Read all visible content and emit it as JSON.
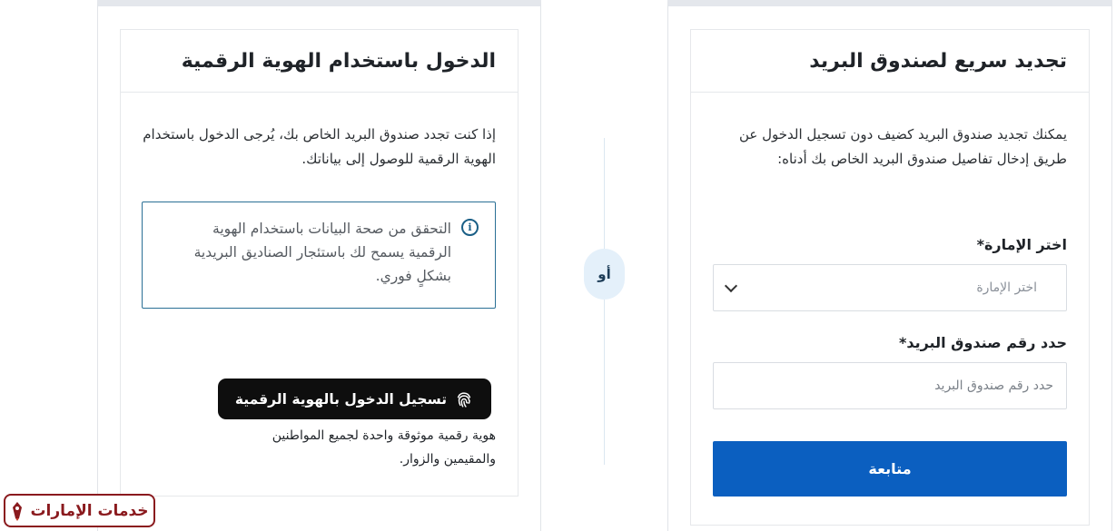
{
  "left_card": {
    "title": "الدخول باستخدام الهوية الرقمية",
    "description": "إذا كنت تجدد صندوق البريد الخاص بك، يُرجى الدخول باستخدام الهوية الرقمية للوصول إلى بياناتك.",
    "info_text": "التحقق من صحة البيانات باستخدام الهوية الرقمية يسمح لك باستئجار الصناديق البريدية بشكلٍ فوري.",
    "uaepass_button_label": "تسجيل الدخول بالهوية الرقمية",
    "uaepass_note": "هوية رقمية موثوقة واحدة لجميع المواطنين والمقيمين والزوار."
  },
  "separator": {
    "or_label": "أو"
  },
  "right_card": {
    "title": "تجديد سريع لصندوق البريد",
    "description": "يمكنك تجديد صندوق البريد كضيف دون تسجيل الدخول عن طريق إدخال تفاصيل صندوق البريد الخاص بك أدناه:",
    "emirate_label": "اختر الإمارة*",
    "emirate_placeholder": "اختر الإمارة",
    "pobox_label": "حدد رقم صندوق البريد*",
    "pobox_placeholder": "حدد رقم صندوق البريد",
    "continue_label": "متابعة"
  },
  "watermark": {
    "text": "خدمات الإمارات"
  },
  "colors": {
    "primary": "#0b5fc0",
    "info_border": "#2a6f95",
    "uaepass_bg": "#0e0e0e",
    "or_bg": "#e4f0fa",
    "logo_red": "#8a1a1e"
  },
  "icons": {
    "info": "info-icon",
    "fingerprint": "fingerprint-icon",
    "chevron": "chevron-down-icon"
  }
}
